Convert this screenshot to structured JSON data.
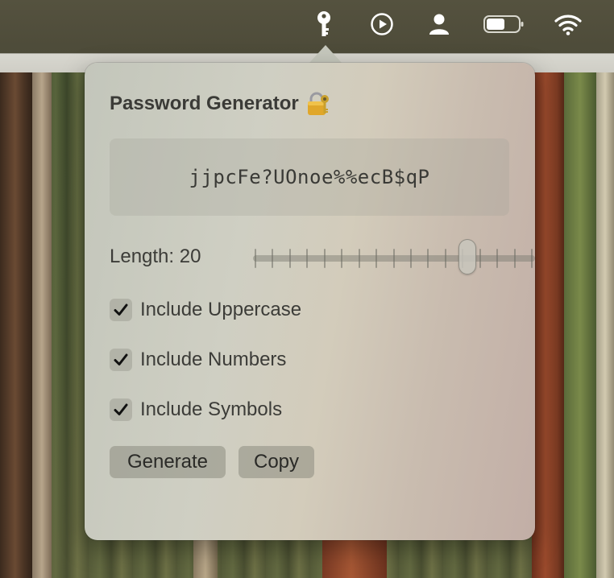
{
  "menubar": {
    "icons": [
      "key-icon",
      "play-icon",
      "user-icon",
      "battery-icon",
      "wifi-icon"
    ]
  },
  "popover": {
    "title": "Password Generator",
    "title_emoji": "lock-with-key-icon",
    "password": "jjpcFe?UOnoe%%ecB$qP",
    "length_label": "Length: 20",
    "length_value": 20,
    "slider_fraction": 0.76,
    "slider_tick_count": 17,
    "options": [
      {
        "label": "Include Uppercase",
        "checked": true
      },
      {
        "label": "Include Numbers",
        "checked": true
      },
      {
        "label": "Include Symbols",
        "checked": true
      }
    ],
    "generate_label": "Generate",
    "copy_label": "Copy"
  }
}
